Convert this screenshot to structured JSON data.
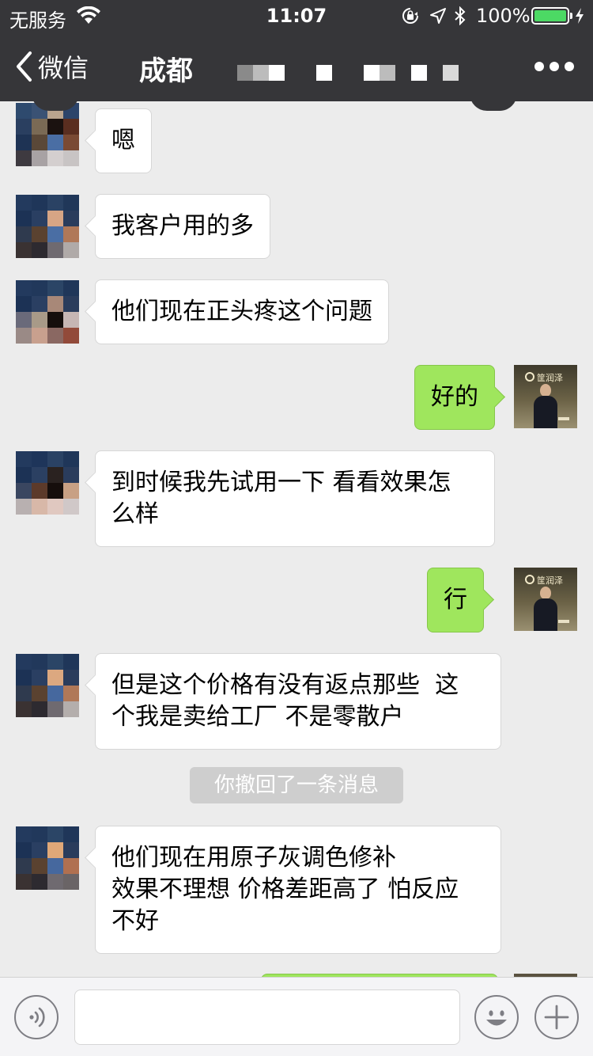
{
  "status_bar": {
    "carrier": "无服务",
    "time": "11:07",
    "battery_percent": "100%",
    "battery_level": 1.0,
    "icons": [
      "wifi-icon",
      "orientation-lock-icon",
      "location-icon",
      "bluetooth-icon",
      "battery-icon",
      "charging-icon"
    ]
  },
  "nav": {
    "back_label": "微信",
    "title": "成都",
    "more_icon": "more-dots-icon"
  },
  "messages": [
    {
      "side": "in",
      "text": "嗯"
    },
    {
      "side": "in",
      "text": "我客户用的多"
    },
    {
      "side": "in",
      "text": "他们现在正头疼这个问题"
    },
    {
      "side": "out",
      "text": "好的"
    },
    {
      "side": "in",
      "lines": [
        "到时候我先试用一下 看看效果怎",
        "么样"
      ]
    },
    {
      "side": "out",
      "text": "行"
    },
    {
      "side": "in",
      "lines": [
        "但是这个价格有没有返点那些  这",
        "个我是卖给工厂 不是零散户"
      ]
    },
    {
      "side": "system",
      "text": "你撤回了一条消息"
    },
    {
      "side": "in",
      "lines": [
        "他们现在用原子灰调色修补",
        "效果不理想 价格差距高了 怕反应",
        "不好"
      ]
    }
  ],
  "my_avatar_logo": "筐润泽",
  "input_bar": {
    "voice_icon": "voice-icon",
    "emoji_icon": "emoji-icon",
    "plus_icon": "plus-icon",
    "text_value": ""
  },
  "colors": {
    "header": "#363639",
    "chat_background": "#ececec",
    "outgoing_bubble": "#9fe65d",
    "incoming_bubble": "#ffffff",
    "battery": "#4cd964"
  }
}
